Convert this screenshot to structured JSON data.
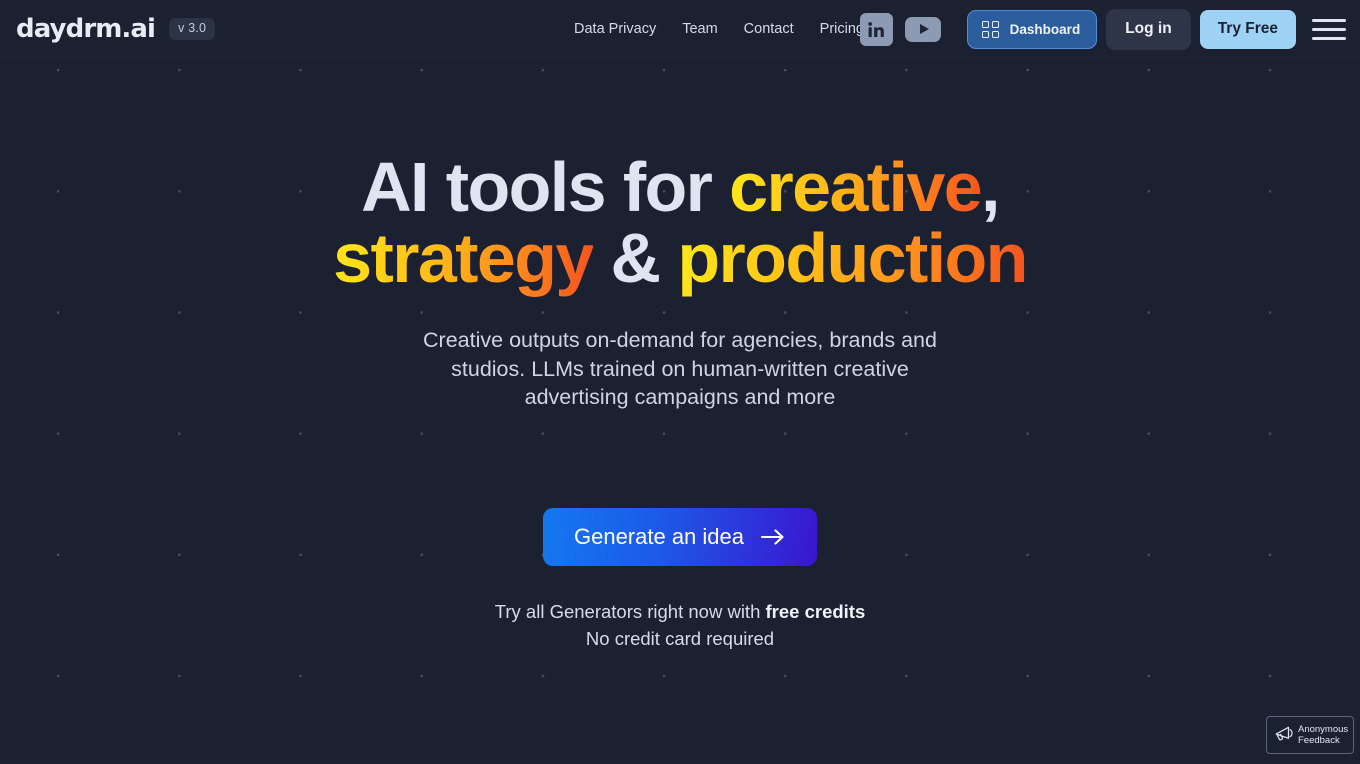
{
  "brand": {
    "logo": "daydrm.ai",
    "version_badge": "v 3.0"
  },
  "header": {
    "nav_links": [
      {
        "label": "Data Privacy"
      },
      {
        "label": "Team"
      },
      {
        "label": "Contact"
      },
      {
        "label": "Pricing"
      }
    ],
    "social": [
      {
        "name": "linkedin-icon",
        "label": "in"
      },
      {
        "name": "youtube-icon",
        "label": "play"
      }
    ],
    "dashboard_label": "Dashboard",
    "login_label": "Log in",
    "try_free_label": "Try Free",
    "menu_icon": "hamburger-icon"
  },
  "hero": {
    "headline": {
      "line1_plain": "AI tools for ",
      "line1_grad": "creative",
      "line1_comma": ",",
      "line2_grad_a": "strategy",
      "line2_amp": " & ",
      "line2_grad_b": "production"
    },
    "subheadline": "Creative outputs on-demand for agencies, brands and studios. LLMs trained on human-written creative advertising campaigns and more",
    "cta_label": "Generate an idea",
    "cta_arrow": "arrow-right-icon",
    "note_line1_prefix": "Try all Generators right now with ",
    "note_line1_bold": "free credits",
    "note_line2": "No credit card required"
  },
  "feedback": {
    "icon": "megaphone-icon",
    "line1": "Anonymous",
    "line2": "Feedback"
  },
  "colors": {
    "page_bg": "#1b2130",
    "headline_plain": "#dfe5f0",
    "grad_start": "#ffe81a",
    "grad_end": "#f4521f",
    "cta_grad_start": "#1478ef",
    "cta_grad_end": "#3a16cf",
    "try_free_bg": "#9ed2f4",
    "dashboard_bg": "#2b5c9e",
    "dashboard_border": "#4e8fd8",
    "login_bg": "#2d3547",
    "social_icon_bg": "#8d9ab4"
  }
}
